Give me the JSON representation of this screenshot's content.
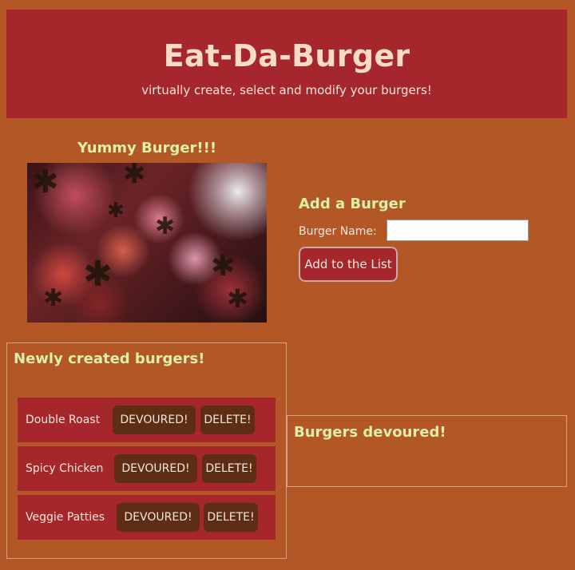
{
  "header": {
    "title": "Eat-Da-Burger",
    "subtitle": "virtually create, select and modify your burgers!"
  },
  "feature": {
    "title": "Yummy Burger!!!"
  },
  "add_form": {
    "title": "Add a Burger",
    "label": "Burger Name:",
    "input_value": "",
    "input_placeholder": "",
    "button_label": "Add to the List"
  },
  "new_burgers": {
    "title": "Newly created burgers!",
    "devoured_label": "DEVOURED!",
    "delete_label": "DELETE!",
    "items": [
      {
        "name": "Double Roast"
      },
      {
        "name": "Spicy Chicken"
      },
      {
        "name": "Veggie Patties"
      }
    ]
  },
  "devoured": {
    "title": "Burgers devoured!"
  },
  "colors": {
    "page_bg": "#b35727",
    "header_bg": "#a5272b",
    "accent_heading": "#dcf0a8",
    "row_bg": "#a5272b",
    "pill_bg": "#5e2e14"
  }
}
